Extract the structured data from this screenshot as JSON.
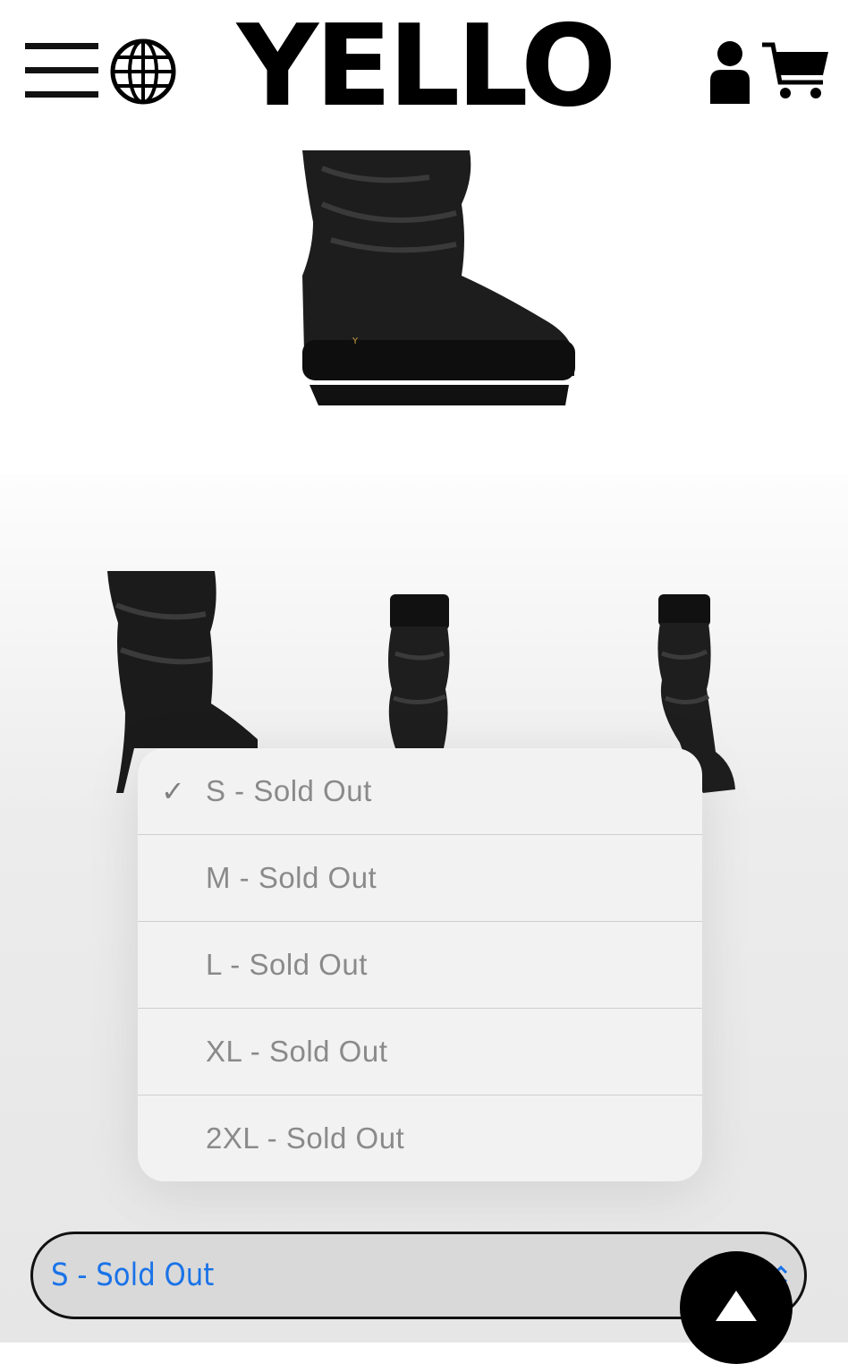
{
  "header": {
    "brand": "YELLO",
    "icons": [
      "menu-icon",
      "globe-icon",
      "user-icon",
      "cart-icon"
    ]
  },
  "product": {
    "images": [
      "main-boot-photo",
      "thumbnail-front",
      "thumbnail-side",
      "thumbnail-back"
    ]
  },
  "size_picker": {
    "options": [
      {
        "label": "S - Sold Out",
        "selected": true
      },
      {
        "label": "M - Sold Out",
        "selected": false
      },
      {
        "label": "L - Sold Out",
        "selected": false
      },
      {
        "label": "XL - Sold Out",
        "selected": false
      },
      {
        "label": "2XL - Sold Out",
        "selected": false
      }
    ],
    "check_mark": "✓",
    "current_value": "S - Sold Out"
  },
  "colors": {
    "accent": "#1a73e8",
    "text_muted": "#8a8a8a",
    "brand": "#000000"
  }
}
